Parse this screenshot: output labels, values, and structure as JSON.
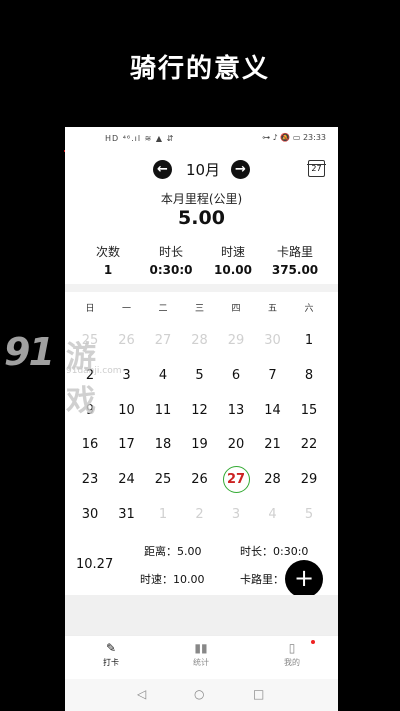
{
  "promo_title": "骑行的意义",
  "status": {
    "left": "HD ⁴⁶.ıl ≋ ▲ ⇵",
    "right": "⊶ ♪ 🔕 ▭ 23:33"
  },
  "month": {
    "label": "10月",
    "prev_icon": "arrow-left",
    "next_icon": "arrow-right",
    "calendar_badge": "27"
  },
  "mileage": {
    "label": "本月里程(公里)",
    "value": "5.00"
  },
  "stats": [
    {
      "label": "次数",
      "value": "1"
    },
    {
      "label": "时长",
      "value": "0:30:0"
    },
    {
      "label": "时速",
      "value": "10.00"
    },
    {
      "label": "卡路里",
      "value": "375.00"
    }
  ],
  "weekdays": [
    "日",
    "一",
    "二",
    "三",
    "四",
    "五",
    "六"
  ],
  "days": [
    {
      "d": "25",
      "m": true
    },
    {
      "d": "26",
      "m": true
    },
    {
      "d": "27",
      "m": true
    },
    {
      "d": "28",
      "m": true
    },
    {
      "d": "29",
      "m": true
    },
    {
      "d": "30",
      "m": true
    },
    {
      "d": "1"
    },
    {
      "d": "2"
    },
    {
      "d": "3"
    },
    {
      "d": "4"
    },
    {
      "d": "5"
    },
    {
      "d": "6"
    },
    {
      "d": "7"
    },
    {
      "d": "8"
    },
    {
      "d": "9"
    },
    {
      "d": "10"
    },
    {
      "d": "11"
    },
    {
      "d": "12"
    },
    {
      "d": "13"
    },
    {
      "d": "14"
    },
    {
      "d": "15"
    },
    {
      "d": "16"
    },
    {
      "d": "17"
    },
    {
      "d": "18"
    },
    {
      "d": "19"
    },
    {
      "d": "20"
    },
    {
      "d": "21"
    },
    {
      "d": "22"
    },
    {
      "d": "23"
    },
    {
      "d": "24"
    },
    {
      "d": "25"
    },
    {
      "d": "26"
    },
    {
      "d": "27",
      "today": true
    },
    {
      "d": "28"
    },
    {
      "d": "29"
    },
    {
      "d": "30"
    },
    {
      "d": "31"
    },
    {
      "d": "1",
      "m": true
    },
    {
      "d": "2",
      "m": true
    },
    {
      "d": "3",
      "m": true
    },
    {
      "d": "4",
      "m": true
    },
    {
      "d": "5",
      "m": true
    }
  ],
  "detail": {
    "date": "10.27",
    "distance": "距离：5.00",
    "duration": "时长：0:30:0",
    "speed": "时速：10.00",
    "calories": "卡路里："
  },
  "fab_label": "+",
  "tabs": [
    {
      "label": "打卡",
      "icon": "edit-icon"
    },
    {
      "label": "统计",
      "icon": "chart-icon"
    },
    {
      "label": "我的",
      "icon": "book-icon"
    }
  ],
  "nav": {
    "back": "◁",
    "home": "○",
    "recent": "□"
  },
  "watermark": {
    "number": "91",
    "text": "游戏",
    "url": "91danji.com"
  }
}
